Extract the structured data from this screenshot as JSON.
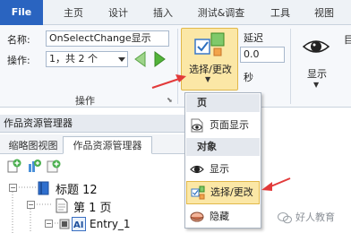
{
  "ribbon_tabs": {
    "file": "File",
    "home": "主页",
    "design": "设计",
    "insert": "插入",
    "test": "测试&调查",
    "tools": "工具",
    "view": "视图"
  },
  "ribbon": {
    "name_label": "名称:",
    "name_value": "OnSelectChange显示",
    "action_label": "操作:",
    "action_value": "1，共 2 个",
    "group_label": "操作",
    "select_change_button": "选择/更改",
    "delay_label": "延迟",
    "delay_value": "0.0",
    "seconds_label": "秒",
    "show_button": "显示"
  },
  "pane": {
    "title": "作品资源管理器",
    "tabs": [
      "缩略图视图",
      "作品资源管理器"
    ],
    "tree": {
      "title_node": "标题 12",
      "page_node": "第 1 页",
      "entry_node": "Entry_1"
    }
  },
  "dropdown": {
    "page_header": "页",
    "page_show": "页面显示",
    "object_header": "对象",
    "show": "显示",
    "select_change": "选择/更改",
    "hide": "隐藏"
  },
  "watermark": "好人教育",
  "colors": {
    "file_tab": "#2a64c0",
    "highlight": "#fbe7a6",
    "highlight_border": "#e1b84a",
    "arrow": "#e23a3a"
  }
}
